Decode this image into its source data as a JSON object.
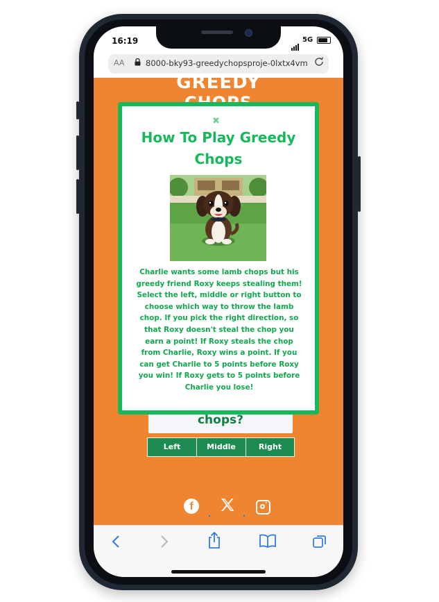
{
  "status_bar": {
    "time": "16:19",
    "network": "5G"
  },
  "browser": {
    "text_size_label": "AA",
    "url": "8000-bky93-greedychopsproje-0lxtx4vm",
    "lock_icon": "lock-icon",
    "reload_icon": "reload-icon"
  },
  "page": {
    "logo_line1": "GREEDY",
    "logo_line2": "CHOPS",
    "question_text": "chops?",
    "choices": [
      "Left",
      "Middle",
      "Right"
    ],
    "social_icons": [
      "facebook-icon",
      "x-icon",
      "instagram-icon"
    ],
    "accent_color": "#ef8530",
    "button_color": "#1d8c52"
  },
  "modal": {
    "close_symbol": "✖",
    "title": "How To Play Greedy Chops",
    "body": "Charlie wants some lamb chops but his greedy friend Roxy keeps stealing them! Select the left, middle or right button to choose which way to throw the lamb chop. If you pick the right direction, so that Roxy doesn't steal the chop you earn a point! If Roxy steals the chop from Charlie, Roxy wins a point. If you can get Charlie to 5 points before Roxy you win! If Roxy gets to 5 points before Charlie you lose!",
    "border_color": "#16b85a",
    "text_color": "#12a84e"
  },
  "bottom_toolbar": {
    "icons": [
      "back-icon",
      "forward-icon",
      "share-icon",
      "bookmarks-icon",
      "tabs-icon"
    ]
  }
}
